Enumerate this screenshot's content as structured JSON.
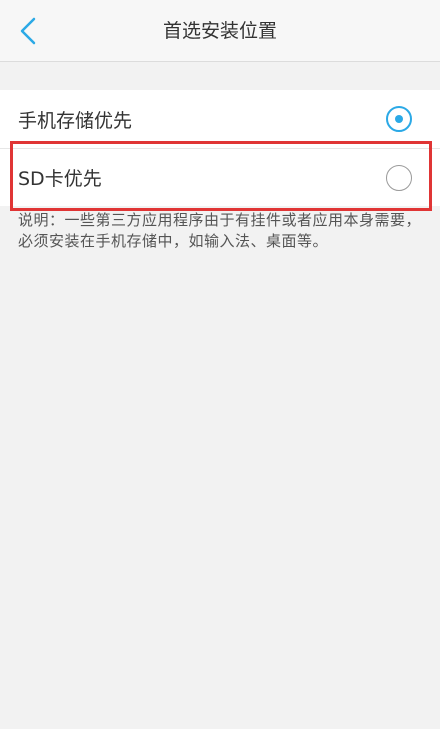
{
  "header": {
    "title": "首选安装位置",
    "back_icon": "chevron-left-icon"
  },
  "options": [
    {
      "label": "手机存储优先",
      "selected": true
    },
    {
      "label": "SD卡优先",
      "selected": false
    }
  ],
  "note": {
    "text": "说明：一些第三方应用程序由于有挂件或者应用本身需要，必须安装在手机存储中，如输入法、桌面等。"
  },
  "colors": {
    "accent": "#2ba9e6",
    "highlight": "#e03535"
  }
}
